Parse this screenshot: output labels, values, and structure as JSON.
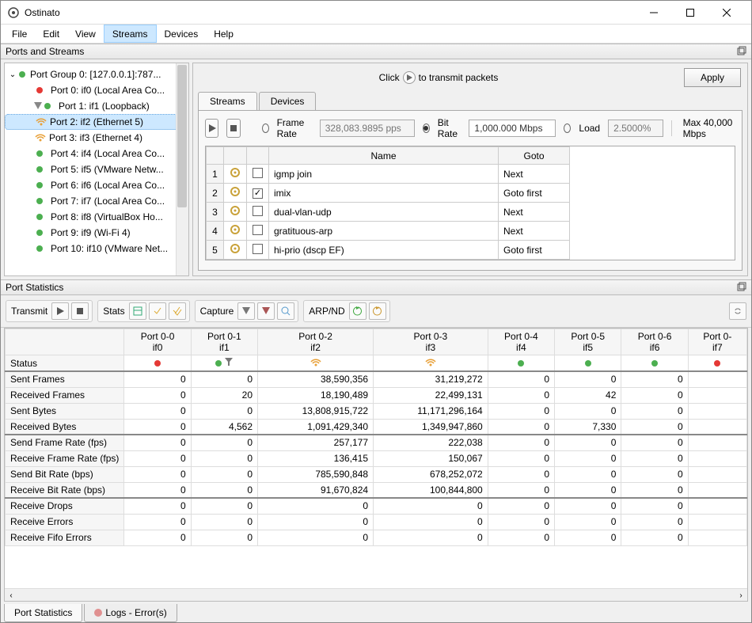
{
  "window": {
    "title": "Ostinato"
  },
  "menu": [
    "File",
    "Edit",
    "View",
    "Streams",
    "Devices",
    "Help"
  ],
  "menu_active": 3,
  "panels": {
    "ports_streams": "Ports and Streams",
    "port_stats": "Port Statistics"
  },
  "tree": {
    "root": "Port Group 0:  [127.0.0.1]:787...",
    "items": [
      {
        "label": "Port 0: if0 (Local Area Co...",
        "status": "red"
      },
      {
        "label": "Port 1: if1 (Loopback)",
        "status": "green",
        "tx": true
      },
      {
        "label": "Port 2: if2 (Ethernet 5)",
        "status": "green",
        "wireless": true,
        "selected": true
      },
      {
        "label": "Port 3: if3 (Ethernet 4)",
        "status": "green",
        "wireless": true
      },
      {
        "label": "Port 4: if4 (Local Area Co...",
        "status": "green"
      },
      {
        "label": "Port 5: if5 (VMware Netw...",
        "status": "green"
      },
      {
        "label": "Port 6: if6 (Local Area Co...",
        "status": "green"
      },
      {
        "label": "Port 7: if7 (Local Area Co...",
        "status": "green"
      },
      {
        "label": "Port 8: if8 (VirtualBox Ho...",
        "status": "green"
      },
      {
        "label": "Port 9: if9 (Wi-Fi 4)",
        "status": "green"
      },
      {
        "label": "Port 10: if10 (VMware Net...",
        "status": "green"
      }
    ]
  },
  "hint": {
    "pre": "Click",
    "post": "to transmit packets"
  },
  "apply": "Apply",
  "tabs": {
    "streams": "Streams",
    "devices": "Devices"
  },
  "rate": {
    "frame_label": "Frame Rate",
    "frame_value": "328,083.9895 pps",
    "bit_label": "Bit Rate",
    "bit_value": "1,000.000 Mbps",
    "load_label": "Load",
    "load_value": "2.5000%",
    "max": "Max 40,000 Mbps"
  },
  "stream_table": {
    "headers": [
      "",
      "",
      "",
      "Name",
      "Goto"
    ],
    "rows": [
      {
        "idx": "1",
        "checked": false,
        "name": "igmp join",
        "goto": "Next"
      },
      {
        "idx": "2",
        "checked": true,
        "name": "imix",
        "goto": "Goto first"
      },
      {
        "idx": "3",
        "checked": false,
        "name": "dual-vlan-udp",
        "goto": "Next"
      },
      {
        "idx": "4",
        "checked": false,
        "name": "gratituous-arp",
        "goto": "Next"
      },
      {
        "idx": "5",
        "checked": false,
        "name": "hi-prio (dscp EF)",
        "goto": "Goto first"
      }
    ]
  },
  "toolbar": {
    "transmit": "Transmit",
    "stats": "Stats",
    "capture": "Capture",
    "arpnd": "ARP/ND"
  },
  "stats": {
    "cols": [
      {
        "h1": "Port 0-0",
        "h2": "if0",
        "status": "red"
      },
      {
        "h1": "Port 0-1",
        "h2": "if1",
        "status": "green",
        "filter": true
      },
      {
        "h1": "Port 0-2",
        "h2": "if2",
        "status": "green",
        "wifi": true
      },
      {
        "h1": "Port 0-3",
        "h2": "if3",
        "status": "green",
        "wifi": true
      },
      {
        "h1": "Port 0-4",
        "h2": "if4",
        "status": "green"
      },
      {
        "h1": "Port 0-5",
        "h2": "if5",
        "status": "green"
      },
      {
        "h1": "Port 0-6",
        "h2": "if6",
        "status": "green"
      },
      {
        "h1": "Port 0-",
        "h2": "if7",
        "status": "red"
      }
    ],
    "rows": [
      {
        "label": "Status",
        "type": "status"
      },
      {
        "label": "Sent Frames",
        "sep": true,
        "vals": [
          "0",
          "0",
          "38,590,356",
          "31,219,272",
          "0",
          "0",
          "0",
          ""
        ]
      },
      {
        "label": "Received Frames",
        "vals": [
          "0",
          "20",
          "18,190,489",
          "22,499,131",
          "0",
          "42",
          "0",
          ""
        ]
      },
      {
        "label": "Sent Bytes",
        "vals": [
          "0",
          "0",
          "13,808,915,722",
          "11,171,296,164",
          "0",
          "0",
          "0",
          ""
        ]
      },
      {
        "label": "Received Bytes",
        "vals": [
          "0",
          "4,562",
          "1,091,429,340",
          "1,349,947,860",
          "0",
          "7,330",
          "0",
          ""
        ]
      },
      {
        "label": "Send Frame Rate (fps)",
        "sep": true,
        "vals": [
          "0",
          "0",
          "257,177",
          "222,038",
          "0",
          "0",
          "0",
          ""
        ]
      },
      {
        "label": "Receive Frame Rate (fps)",
        "vals": [
          "0",
          "0",
          "136,415",
          "150,067",
          "0",
          "0",
          "0",
          ""
        ]
      },
      {
        "label": "Send Bit Rate (bps)",
        "vals": [
          "0",
          "0",
          "785,590,848",
          "678,252,072",
          "0",
          "0",
          "0",
          ""
        ]
      },
      {
        "label": "Receive Bit Rate (bps)",
        "vals": [
          "0",
          "0",
          "91,670,824",
          "100,844,800",
          "0",
          "0",
          "0",
          ""
        ]
      },
      {
        "label": "Receive Drops",
        "sep": true,
        "vals": [
          "0",
          "0",
          "0",
          "0",
          "0",
          "0",
          "0",
          ""
        ]
      },
      {
        "label": "Receive Errors",
        "vals": [
          "0",
          "0",
          "0",
          "0",
          "0",
          "0",
          "0",
          ""
        ]
      },
      {
        "label": "Receive Fifo Errors",
        "vals": [
          "0",
          "0",
          "0",
          "0",
          "0",
          "0",
          "0",
          ""
        ]
      }
    ]
  },
  "bottom_tabs": {
    "stats": "Port Statistics",
    "logs": "Logs - Error(s)"
  }
}
